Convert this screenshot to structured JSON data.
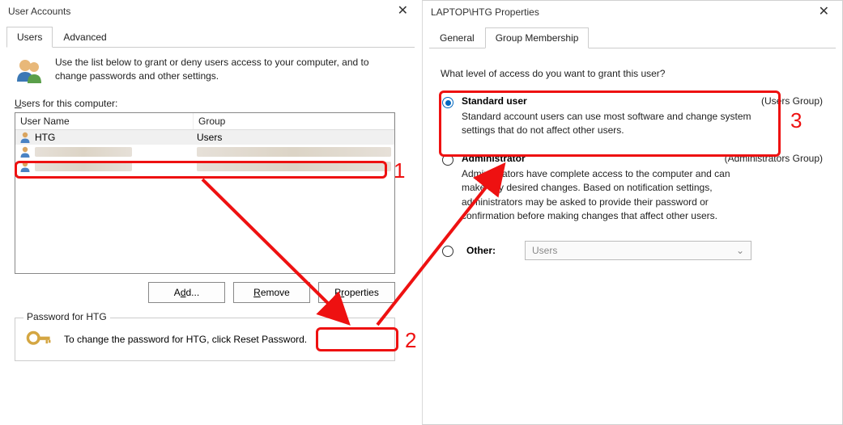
{
  "left": {
    "title": "User Accounts",
    "tabs": {
      "users": "Users",
      "advanced": "Advanced",
      "active": "users"
    },
    "intro": "Use the list below to grant or deny users access to your computer, and to change passwords and other settings.",
    "users_label_pre": "U",
    "users_label_rest": "sers for this computer:",
    "columns": {
      "name": "User Name",
      "group": "Group"
    },
    "rows": [
      {
        "name": "HTG",
        "group": "Users",
        "selected": true
      },
      {
        "name": "",
        "group": "",
        "blurred": true
      },
      {
        "name": "",
        "group": "",
        "blurred": true
      }
    ],
    "buttons": {
      "add_pre": "A",
      "add_mid": "d",
      "add_post": "d...",
      "remove_pre": "",
      "remove_mid": "R",
      "remove_post": "emove",
      "props_pre": "P",
      "props_mid": "r",
      "props_post": "operties"
    },
    "pw_legend": "Password for HTG",
    "pw_text": "To change the password for HTG, click Reset Password."
  },
  "right": {
    "title": "LAPTOP\\HTG Properties",
    "tabs": {
      "general": "General",
      "group": "Group Membership",
      "active": "group"
    },
    "question": "What level of access do you want to grant this user?",
    "options": {
      "standard": {
        "title": "Standard user",
        "group": "(Users Group)",
        "desc": "Standard account users can use most software and change system settings that do not affect other users."
      },
      "admin": {
        "title": "Administrator",
        "group": "(Administrators Group)",
        "desc": "Administrators have complete access to the computer and can make any desired changes. Based on notification settings, administrators may be asked to provide their password or confirmation before making changes that affect other users."
      },
      "other": {
        "title": "Other:",
        "combo": "Users"
      }
    }
  },
  "annotations": {
    "n1": "1",
    "n2": "2",
    "n3": "3"
  }
}
